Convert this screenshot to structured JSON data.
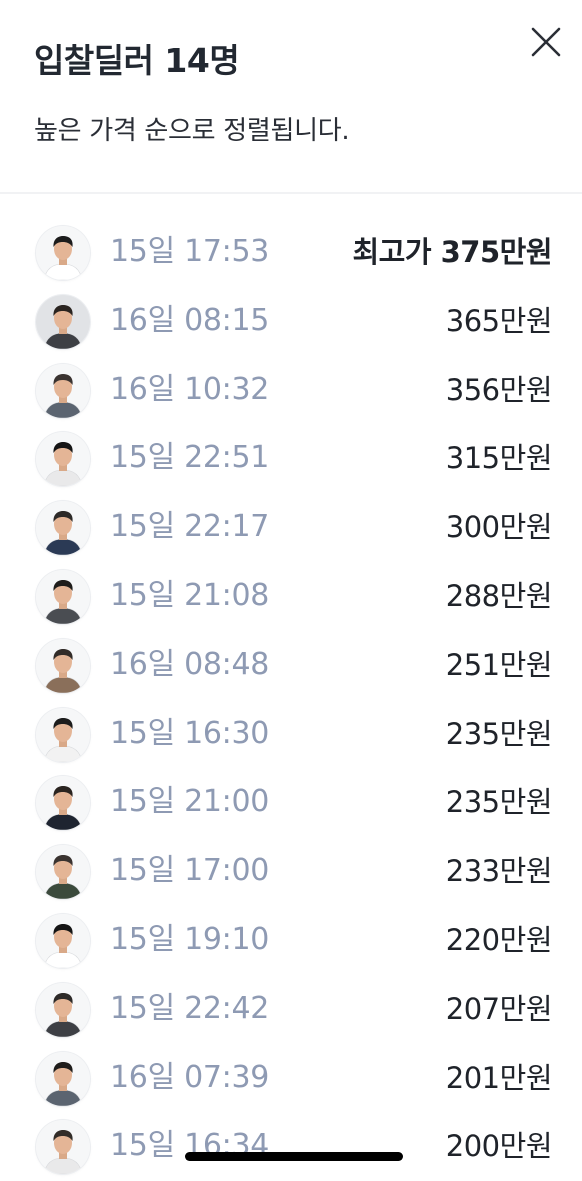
{
  "header": {
    "title": "입찰딜러 14명",
    "subtitle": "높은 가격 순으로 정렬됩니다."
  },
  "colors": {
    "time_text": "#8e9ab3",
    "amount_text": "#1f232a",
    "title_text": "#222831"
  },
  "icons": {
    "close": "close-icon"
  },
  "bids": [
    {
      "time": "15일 17:53",
      "amount": "최고가 375만원",
      "top": true
    },
    {
      "time": "16일 08:15",
      "amount": "365만원"
    },
    {
      "time": "16일 10:32",
      "amount": "356만원"
    },
    {
      "time": "15일 22:51",
      "amount": "315만원"
    },
    {
      "time": "15일 22:17",
      "amount": "300만원"
    },
    {
      "time": "15일 21:08",
      "amount": "288만원"
    },
    {
      "time": "16일 08:48",
      "amount": "251만원"
    },
    {
      "time": "15일 16:30",
      "amount": "235만원"
    },
    {
      "time": "15일 21:00",
      "amount": "235만원"
    },
    {
      "time": "15일 17:00",
      "amount": "233만원"
    },
    {
      "time": "15일 19:10",
      "amount": "220만원"
    },
    {
      "time": "15일 22:42",
      "amount": "207만원"
    },
    {
      "time": "16일 07:39",
      "amount": "201만원"
    },
    {
      "time": "15일 16:34",
      "amount": "200만원"
    }
  ]
}
